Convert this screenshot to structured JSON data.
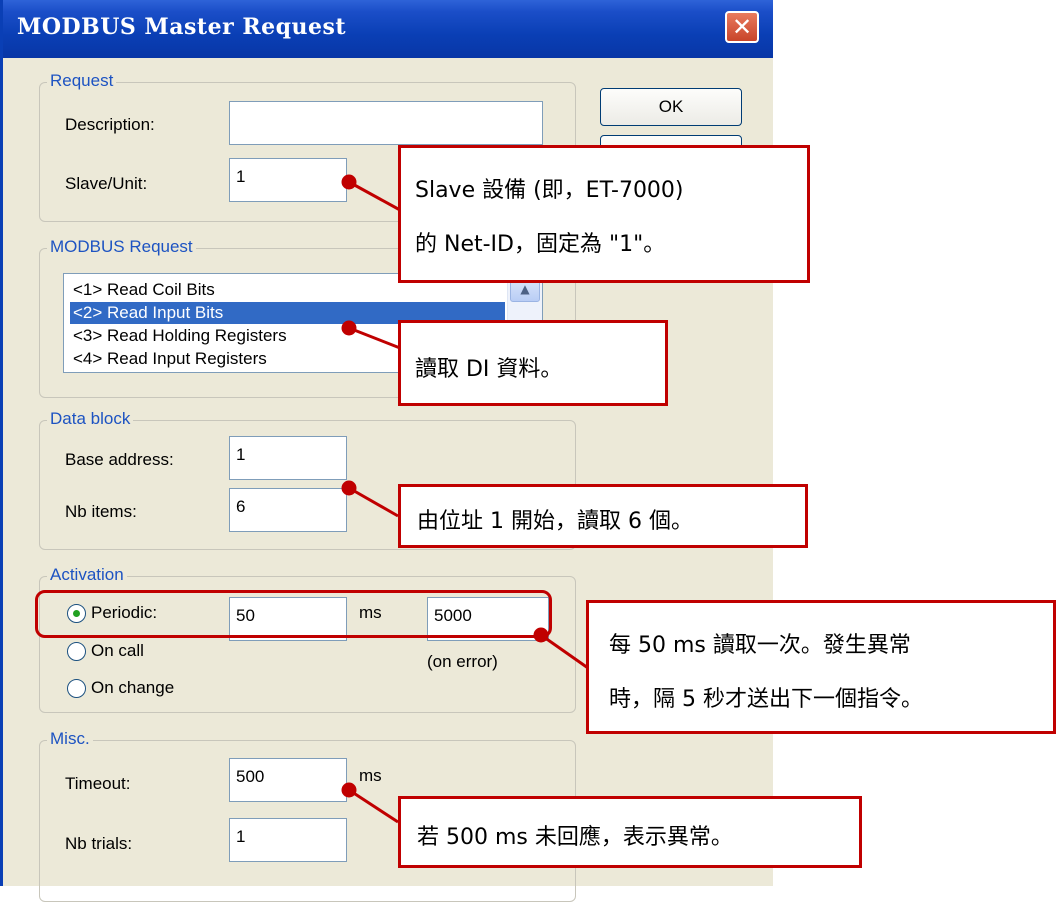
{
  "dialog": {
    "title": "MODBUS Master Request",
    "close_glyph": "✕",
    "ok_label": "OK"
  },
  "request": {
    "group_label": "Request",
    "description_label": "Description:",
    "description_value": "",
    "slave_label": "Slave/Unit:",
    "slave_value": "1"
  },
  "modbus_request": {
    "group_label": "MODBUS Request",
    "items": [
      {
        "label": "<1> Read Coil Bits",
        "selected": false
      },
      {
        "label": "<2> Read Input Bits",
        "selected": true
      },
      {
        "label": "<3> Read Holding Registers",
        "selected": false
      },
      {
        "label": "<4> Read Input Registers",
        "selected": false
      }
    ]
  },
  "data_block": {
    "group_label": "Data block",
    "base_address_label": "Base address:",
    "base_address_value": "1",
    "nb_items_label": "Nb items:",
    "nb_items_value": "6"
  },
  "activation": {
    "group_label": "Activation",
    "periodic_label": "Periodic:",
    "periodic_value": "50",
    "periodic_unit": "ms",
    "error_value": "5000",
    "error_note": "(on error)",
    "on_call_label": "On call",
    "on_change_label": "On change",
    "selected": "Periodic"
  },
  "misc": {
    "group_label": "Misc.",
    "timeout_label": "Timeout:",
    "timeout_value": "500",
    "timeout_unit": "ms",
    "nb_trials_label": "Nb trials:",
    "nb_trials_value": "1"
  },
  "callouts": {
    "slave_line1": "Slave 設備 (即，ET-7000)",
    "slave_line2": "的 Net-ID，固定為 \"1\"。",
    "request": "讀取 DI 資料。",
    "data_block": "由位址 1 開始，讀取 6 個。",
    "activation_line1": "每 50 ms 讀取一次。發生異常",
    "activation_line2": "時，隔 5 秒才送出下一個指令。",
    "timeout": "若 500 ms 未回應，表示異常。"
  },
  "colors": {
    "titlebar": "#0a3fb5",
    "dialog_bg": "#ece9d8",
    "group_label": "#1d53c2",
    "selection": "#316ac5",
    "callout_border": "#c00000"
  }
}
